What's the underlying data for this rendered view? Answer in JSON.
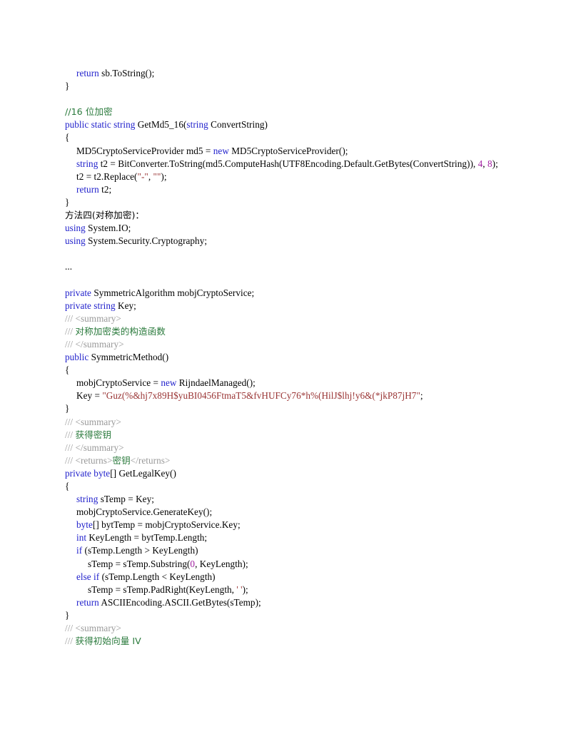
{
  "document": {
    "type": "code-listing",
    "language": "C#",
    "page_background": "#ffffff",
    "syntax_colors": {
      "keyword": "#2222cc",
      "comment": "#2a7a3c",
      "doc_tag": "#9a9a9a",
      "string": "#993333",
      "number": "#a020a0",
      "plain": "#000000"
    },
    "lines": [
      {
        "indent": 1,
        "segments": [
          {
            "t": "return",
            "c": "kw"
          },
          {
            "t": " sb.ToString();",
            "c": "plain"
          }
        ]
      },
      {
        "indent": 0,
        "segments": [
          {
            "t": "}",
            "c": "plain"
          }
        ]
      },
      {
        "indent": 0,
        "segments": []
      },
      {
        "indent": 0,
        "segments": [
          {
            "t": "//16 位加密",
            "c": "cmt"
          }
        ]
      },
      {
        "indent": 0,
        "segments": [
          {
            "t": "public static string",
            "c": "kw"
          },
          {
            "t": " GetMd5_16(",
            "c": "plain"
          },
          {
            "t": "string",
            "c": "kw"
          },
          {
            "t": " ConvertString)",
            "c": "plain"
          }
        ]
      },
      {
        "indent": 0,
        "segments": [
          {
            "t": "{",
            "c": "plain"
          }
        ]
      },
      {
        "indent": 1,
        "segments": [
          {
            "t": "MD5CryptoServiceProvider md5 = ",
            "c": "plain"
          },
          {
            "t": "new",
            "c": "kw"
          },
          {
            "t": " MD5CryptoServiceProvider();",
            "c": "plain"
          }
        ]
      },
      {
        "indent": 1,
        "segments": [
          {
            "t": "string",
            "c": "kw"
          },
          {
            "t": " t2 = BitConverter.ToString(md5.ComputeHash(UTF8Encoding.Default.GetBytes(ConvertString)), ",
            "c": "plain"
          },
          {
            "t": "4",
            "c": "num"
          },
          {
            "t": ", ",
            "c": "plain"
          },
          {
            "t": "8",
            "c": "num"
          },
          {
            "t": ");",
            "c": "plain"
          }
        ]
      },
      {
        "indent": 1,
        "segments": [
          {
            "t": "t2 = t2.Replace(",
            "c": "plain"
          },
          {
            "t": "\"-\"",
            "c": "str"
          },
          {
            "t": ", ",
            "c": "plain"
          },
          {
            "t": "\"\"",
            "c": "str"
          },
          {
            "t": ");",
            "c": "plain"
          }
        ]
      },
      {
        "indent": 1,
        "segments": [
          {
            "t": "return",
            "c": "kw"
          },
          {
            "t": " t2;",
            "c": "plain"
          }
        ]
      },
      {
        "indent": 0,
        "segments": [
          {
            "t": "}",
            "c": "plain"
          }
        ]
      },
      {
        "indent": 0,
        "segments": [
          {
            "t": "方法四(对称加密)：",
            "c": "plain"
          }
        ]
      },
      {
        "indent": 0,
        "segments": [
          {
            "t": "using",
            "c": "kw"
          },
          {
            "t": " System.IO;",
            "c": "plain"
          }
        ]
      },
      {
        "indent": 0,
        "segments": [
          {
            "t": "using",
            "c": "kw"
          },
          {
            "t": " System.Security.Cryptography;",
            "c": "plain"
          }
        ]
      },
      {
        "indent": 0,
        "segments": []
      },
      {
        "indent": 0,
        "segments": [
          {
            "t": "...",
            "c": "plain"
          }
        ]
      },
      {
        "indent": 0,
        "segments": []
      },
      {
        "indent": 0,
        "segments": [
          {
            "t": "private",
            "c": "kw"
          },
          {
            "t": " SymmetricAlgorithm mobjCryptoService;",
            "c": "plain"
          }
        ]
      },
      {
        "indent": 0,
        "segments": [
          {
            "t": "private string",
            "c": "kw"
          },
          {
            "t": " Key;",
            "c": "plain"
          }
        ]
      },
      {
        "indent": 0,
        "segments": [
          {
            "t": "/// <summary>",
            "c": "doc"
          }
        ]
      },
      {
        "indent": 0,
        "segments": [
          {
            "t": "/// ",
            "c": "doc"
          },
          {
            "t": "对称加密类的构造函数",
            "c": "cmt"
          }
        ]
      },
      {
        "indent": 0,
        "segments": [
          {
            "t": "/// </summary>",
            "c": "doc"
          }
        ]
      },
      {
        "indent": 0,
        "segments": [
          {
            "t": "public",
            "c": "kw"
          },
          {
            "t": " SymmetricMethod()",
            "c": "plain"
          }
        ]
      },
      {
        "indent": 0,
        "segments": [
          {
            "t": "{",
            "c": "plain"
          }
        ]
      },
      {
        "indent": 1,
        "segments": [
          {
            "t": "mobjCryptoService = ",
            "c": "plain"
          },
          {
            "t": "new",
            "c": "kw"
          },
          {
            "t": " RijndaelManaged();",
            "c": "plain"
          }
        ]
      },
      {
        "indent": 1,
        "segments": [
          {
            "t": "Key = ",
            "c": "plain"
          },
          {
            "t": "\"Guz(%&hj7x89H$yuBI0456FtmaT5&fvHUFCy76*h%(HilJ$lhj!y6&(*jkP87jH7\"",
            "c": "str"
          },
          {
            "t": ";",
            "c": "plain"
          }
        ]
      },
      {
        "indent": 0,
        "segments": [
          {
            "t": "}",
            "c": "plain"
          }
        ]
      },
      {
        "indent": 0,
        "segments": [
          {
            "t": "/// <summary>",
            "c": "doc"
          }
        ]
      },
      {
        "indent": 0,
        "segments": [
          {
            "t": "/// ",
            "c": "doc"
          },
          {
            "t": "获得密钥",
            "c": "cmt"
          }
        ]
      },
      {
        "indent": 0,
        "segments": [
          {
            "t": "/// </summary>",
            "c": "doc"
          }
        ]
      },
      {
        "indent": 0,
        "segments": [
          {
            "t": "/// <returns>",
            "c": "doc"
          },
          {
            "t": "密钥",
            "c": "cmt"
          },
          {
            "t": "</returns>",
            "c": "doc"
          }
        ]
      },
      {
        "indent": 0,
        "segments": [
          {
            "t": "private byte",
            "c": "kw"
          },
          {
            "t": "[] GetLegalKey()",
            "c": "plain"
          }
        ]
      },
      {
        "indent": 0,
        "segments": [
          {
            "t": "{",
            "c": "plain"
          }
        ]
      },
      {
        "indent": 1,
        "segments": [
          {
            "t": "string",
            "c": "kw"
          },
          {
            "t": " sTemp = Key;",
            "c": "plain"
          }
        ]
      },
      {
        "indent": 1,
        "segments": [
          {
            "t": "mobjCryptoService.GenerateKey();",
            "c": "plain"
          }
        ]
      },
      {
        "indent": 1,
        "segments": [
          {
            "t": "byte",
            "c": "kw"
          },
          {
            "t": "[] bytTemp = mobjCryptoService.Key;",
            "c": "plain"
          }
        ]
      },
      {
        "indent": 1,
        "segments": [
          {
            "t": "int",
            "c": "kw"
          },
          {
            "t": " KeyLength = bytTemp.Length;",
            "c": "plain"
          }
        ]
      },
      {
        "indent": 1,
        "segments": [
          {
            "t": "if",
            "c": "kw"
          },
          {
            "t": " (sTemp.Length > KeyLength)",
            "c": "plain"
          }
        ]
      },
      {
        "indent": 2,
        "segments": [
          {
            "t": "sTemp = sTemp.Substring(",
            "c": "plain"
          },
          {
            "t": "0",
            "c": "num"
          },
          {
            "t": ", KeyLength);",
            "c": "plain"
          }
        ]
      },
      {
        "indent": 1,
        "segments": [
          {
            "t": "else if",
            "c": "kw"
          },
          {
            "t": " (sTemp.Length < KeyLength)",
            "c": "plain"
          }
        ]
      },
      {
        "indent": 2,
        "segments": [
          {
            "t": "sTemp = sTemp.PadRight(KeyLength, ",
            "c": "plain"
          },
          {
            "t": "' '",
            "c": "str"
          },
          {
            "t": ");",
            "c": "plain"
          }
        ]
      },
      {
        "indent": 1,
        "segments": [
          {
            "t": "return",
            "c": "kw"
          },
          {
            "t": " ASCIIEncoding.ASCII.GetBytes(sTemp);",
            "c": "plain"
          }
        ]
      },
      {
        "indent": 0,
        "segments": [
          {
            "t": "}",
            "c": "plain"
          }
        ]
      },
      {
        "indent": 0,
        "segments": [
          {
            "t": "/// <summary>",
            "c": "doc"
          }
        ]
      },
      {
        "indent": 0,
        "segments": [
          {
            "t": "/// ",
            "c": "doc"
          },
          {
            "t": "获得初始向量 IV",
            "c": "cmt"
          }
        ]
      }
    ]
  }
}
